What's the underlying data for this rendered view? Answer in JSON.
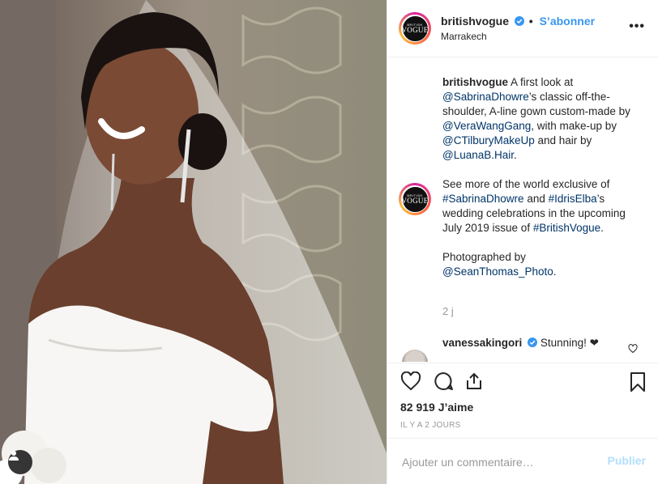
{
  "post": {
    "username": "britishvogue",
    "follow_label": "S’abonner",
    "dot": "•",
    "location": "Marrakech",
    "more_label": "•••",
    "avatar_text_top": "BRITISH",
    "avatar_text_bottom": "VOGUE"
  },
  "caption": {
    "username": "britishvogue",
    "p1_text_1": " A first look at ",
    "mention_1": "@SabrinaDhowre",
    "p1_text_2": "’s classic off-the-shoulder, A-line gown custom-made by ",
    "mention_2": "@VeraWangGang",
    "p1_text_3": ", with make-up by ",
    "mention_3": "@CTilburyMakeUp",
    "p1_text_4": " and hair by ",
    "mention_4": "@LuanaB.Hair",
    "p1_text_5": ".",
    "p2_text_1": "See more of the world exclusive of ",
    "hashtag_1": "#SabrinaDhowre",
    "p2_text_2": " and ",
    "hashtag_2": "#IdrisElba",
    "p2_text_3": "’s wedding celebrations in the upcoming July 2019 issue of ",
    "hashtag_3": "#BritishVogue",
    "p2_text_4": ".",
    "p3_text_1": "Photographed by",
    "mention_5": "@SeanThomas_Photo",
    "p3_text_2": ".",
    "age": "2 j"
  },
  "comment": {
    "username": "vanessakingori",
    "text": " Stunning! ❤"
  },
  "actions": {
    "likes": "82 919 J’aime",
    "time": "IL Y A 2 JOURS"
  },
  "add_comment": {
    "placeholder": "Ajouter un commentaire…",
    "publish_label": "Publier"
  },
  "colors": {
    "accent": "#3897f0",
    "link": "#003569",
    "verified": "#3897f0"
  }
}
